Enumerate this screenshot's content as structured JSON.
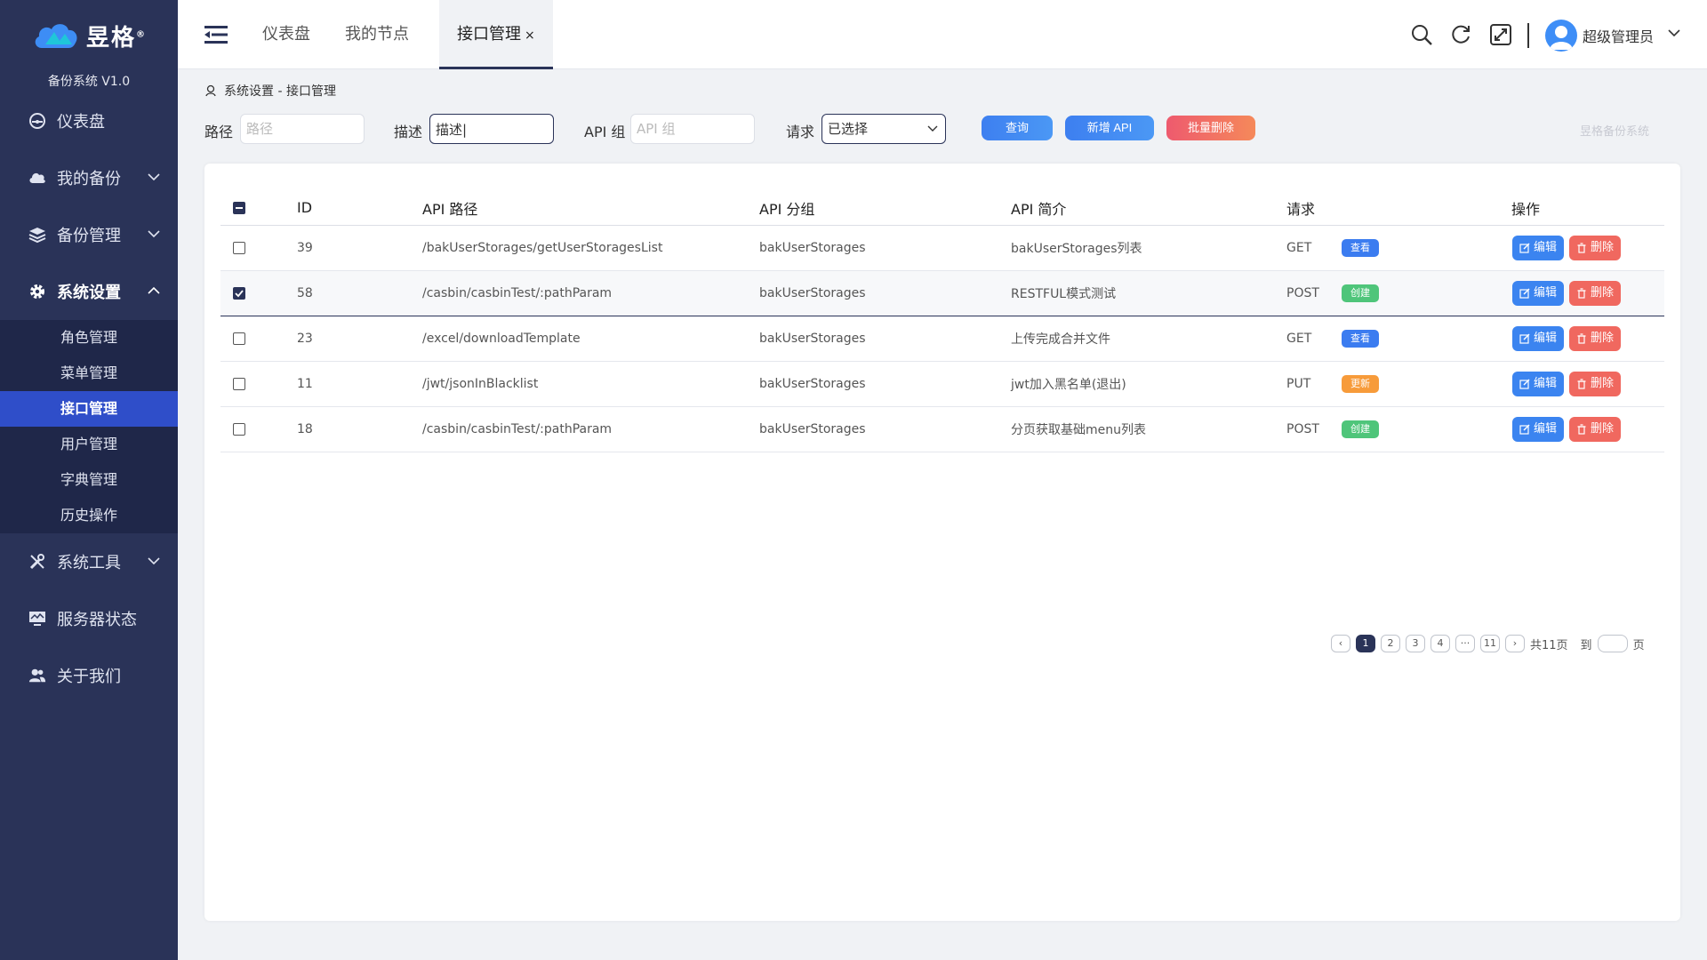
{
  "app": {
    "logo_text": "昱格",
    "version": "备份系统 V1.0"
  },
  "sidebar": {
    "items": [
      {
        "label": "仪表盘",
        "icon": "dashboard-icon"
      },
      {
        "label": "我的备份",
        "icon": "cloud-icon"
      },
      {
        "label": "备份管理",
        "icon": "layers-icon"
      },
      {
        "label": "系统设置",
        "icon": "gear-icon"
      },
      {
        "label": "系统工具",
        "icon": "tools-icon"
      },
      {
        "label": "服务器状态",
        "icon": "monitor-icon"
      },
      {
        "label": "关于我们",
        "icon": "users-icon"
      }
    ],
    "sub_items": [
      "角色管理",
      "菜单管理",
      "接口管理",
      "用户管理",
      "字典管理",
      "历史操作"
    ]
  },
  "header": {
    "tabs": [
      "仪表盘",
      "我的节点",
      "接口管理"
    ],
    "tab_close": "×",
    "username": "超级管理员"
  },
  "breadcrumb": {
    "text": "系统设置 - 接口管理"
  },
  "filter": {
    "path_label": "路径",
    "path_placeholder": "路径",
    "desc_label": "描述",
    "desc_value": "描述|",
    "group_label": "API 组",
    "group_placeholder": "API 组",
    "method_label": "请求",
    "method_value": "已选择",
    "query_btn": "查询",
    "add_btn": "新增 API",
    "batch_delete_btn": "批量删除",
    "watermark": "昱格备份系统"
  },
  "table": {
    "headers": {
      "id": "ID",
      "path": "API 路径",
      "group": "API 分组",
      "desc": "API 简介",
      "method": "请求",
      "ops": "操作"
    },
    "rows": [
      {
        "id": "39",
        "path": "/bakUserStorages/getUserStoragesList",
        "group": "bakUserStorages",
        "desc": "bakUserStorages列表",
        "method": "GET",
        "badge": "查看",
        "badge_type": "view",
        "checked": false
      },
      {
        "id": "58",
        "path": "/casbin/casbinTest/:pathParam",
        "group": "bakUserStorages",
        "desc": "RESTFUL模式测试",
        "method": "POST",
        "badge": "创建",
        "badge_type": "create",
        "checked": true
      },
      {
        "id": "23",
        "path": "/excel/downloadTemplate",
        "group": "bakUserStorages",
        "desc": "上传完成合并文件",
        "method": "GET",
        "badge": "查看",
        "badge_type": "view",
        "checked": false
      },
      {
        "id": "11",
        "path": "/jwt/jsonInBlacklist",
        "group": "bakUserStorages",
        "desc": "jwt加入黑名单(退出)",
        "method": "PUT",
        "badge": "更新",
        "badge_type": "update",
        "checked": false
      },
      {
        "id": "18",
        "path": "/casbin/casbinTest/:pathParam",
        "group": "bakUserStorages",
        "desc": "分页获取基础menu列表",
        "method": "POST",
        "badge": "创建",
        "badge_type": "create",
        "checked": false
      }
    ],
    "edit_label": "编辑",
    "delete_label": "删除"
  },
  "pagination": {
    "pages": [
      "1",
      "2",
      "3",
      "4",
      "···",
      "11"
    ],
    "total": "共11页",
    "goto_label": "到",
    "page_suffix": "页"
  },
  "colors": {
    "sidebar": "#2a3358",
    "active_sub": "#2f4ec9",
    "primary": "#3d7ff0",
    "danger": "#ee5a6e"
  }
}
